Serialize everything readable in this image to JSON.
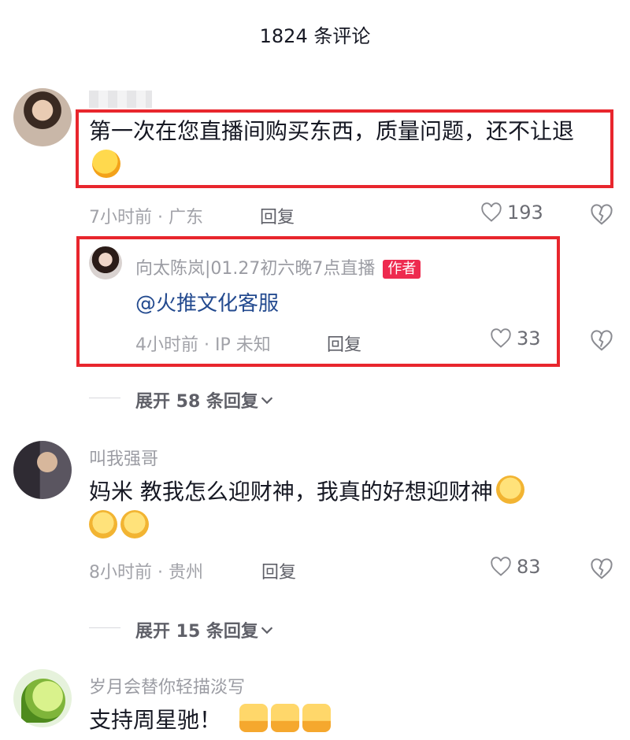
{
  "header": {
    "title": "1824 条评论"
  },
  "comments": [
    {
      "username": "",
      "text": "第一次在您直播间购买东西，质量问题，还不让退",
      "time_location": "7小时前 · 广东",
      "reply_label": "回复",
      "likes": "193",
      "reply": {
        "username": "向太陈岚|01.27初六晚7点直播",
        "badge": "作者",
        "text": "@火推文化客服",
        "time_location": "4小时前 · IP 未知",
        "reply_label": "回复",
        "likes": "33"
      },
      "expand_label": "展开 58 条回复"
    },
    {
      "username": "叫我强哥",
      "text": "妈米 教我怎么迎财神，我真的好想迎财神",
      "time_location": "8小时前 · 贵州",
      "reply_label": "回复",
      "likes": "83",
      "expand_label": "展开 15 条回复"
    },
    {
      "username": "岁月会替你轻描淡写",
      "text": "支持周星驰！"
    }
  ],
  "icons": {
    "like": "heart-outline-icon",
    "dislike": "broken-heart-icon",
    "expand": "chevron-down-icon"
  },
  "colors": {
    "highlight_box": "#e8262d",
    "author_badge": "#ee2a4f",
    "mention": "#234a8f"
  }
}
